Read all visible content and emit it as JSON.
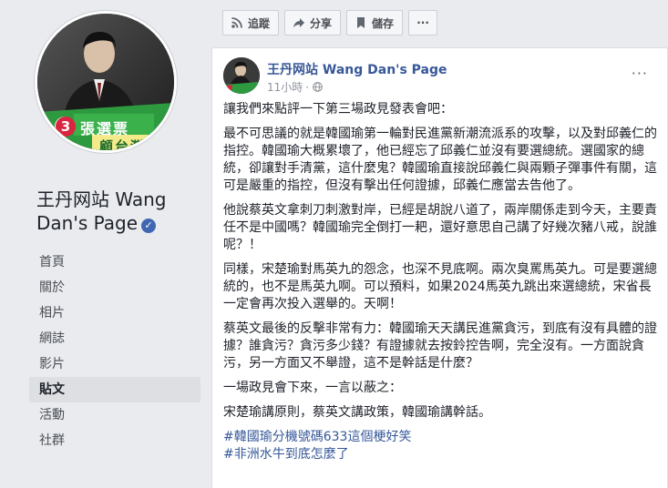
{
  "page": {
    "name_line1": "王丹网站 Wang",
    "name_line2": "Dan's Page",
    "profile_badge_number": "3",
    "profile_banner_line1": "張選票",
    "profile_banner_line2": "顧台灣"
  },
  "nav": {
    "items": [
      {
        "label": "首頁"
      },
      {
        "label": "關於"
      },
      {
        "label": "相片"
      },
      {
        "label": "網誌"
      },
      {
        "label": "影片"
      },
      {
        "label": "貼文",
        "active": true
      },
      {
        "label": "活動"
      },
      {
        "label": "社群"
      }
    ]
  },
  "actions": {
    "follow_label": "追蹤",
    "share_label": "分享",
    "save_label": "儲存",
    "more_label": "···"
  },
  "post": {
    "author": "王丹网站 Wang Dan's Page",
    "time": "11小時",
    "time_separator": "·",
    "menu_label": "···",
    "paragraphs": [
      "讓我們來點評一下第三場政見發表會吧：",
      "最不可思議的就是韓國瑜第一輪對民進黨新潮流派系的攻擊，以及對邱義仁的指控。韓國瑜大概累壞了，他已經忘了邱義仁並沒有要選總統。選國家的總統，卻讓對手清黨，這什麼鬼？韓國瑜直接說邱義仁與兩顆子彈事件有關，這可是嚴重的指控，但沒有擊出任何證據，邱義仁應當去告他了。",
      "他說蔡英文拿刺刀刺激對岸，已經是胡說八道了，兩岸關係走到今天，主要責任不是中國嗎？韓國瑜完全倒打一耙，還好意思自己講了好幾次豬八戒，說誰呢？！",
      "同樣，宋楚瑜對馬英九的怨念，也深不見底啊。兩次臭罵馬英九。可是要選總統的，也不是馬英九啊。可以預料，如果2024馬英九跳出來選總統，宋省長一定會再次投入選舉的。天啊！",
      "蔡英文最後的反擊非常有力：韓國瑜天天講民進黨貪污，到底有沒有具體的證據？誰貪污？貪污多少錢？有證據就去按鈴控告啊，完全沒有。一方面說貪污，另一方面又不舉證，這不是幹話是什麼？",
      "一場政見會下來，一言以蔽之：",
      "宋楚瑜講原則，蔡英文講政策，韓國瑜講幹話。"
    ],
    "hashtags": [
      "#韓國瑜分機號碼633這個梗好笑",
      "#非洲水牛到底怎麼了"
    ]
  },
  "colors": {
    "link": "#385898",
    "hashtag": "#365899",
    "background": "#e9ebee",
    "verified": "#4267b2"
  },
  "icons": {
    "follow": "rss-icon",
    "share": "share-arrow-icon",
    "save": "bookmark-icon",
    "privacy": "globe-icon"
  }
}
